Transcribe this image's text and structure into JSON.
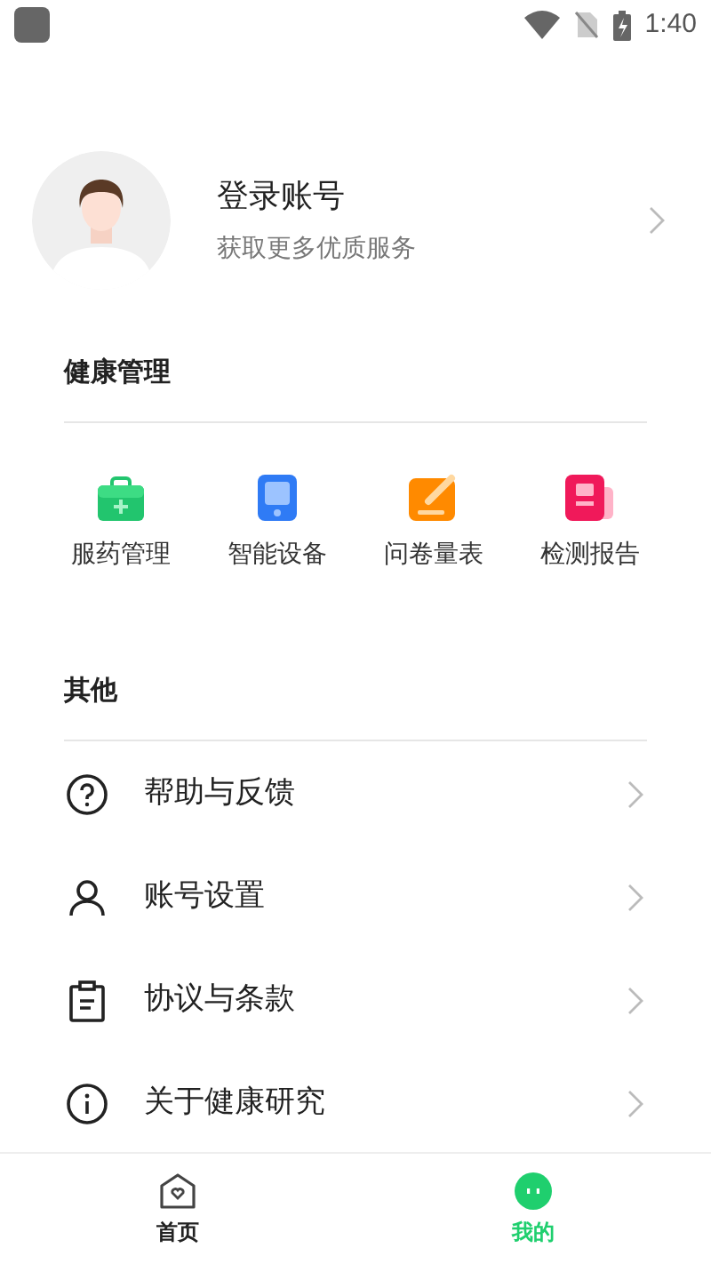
{
  "status_bar": {
    "time": "1:40"
  },
  "profile": {
    "name": "登录账号",
    "subtitle": "获取更多优质服务"
  },
  "health": {
    "title": "健康管理",
    "items": [
      {
        "label": "服药管理",
        "kind": "medicine"
      },
      {
        "label": "智能设备",
        "kind": "device"
      },
      {
        "label": "问卷量表",
        "kind": "survey"
      },
      {
        "label": "检测报告",
        "kind": "report"
      }
    ]
  },
  "other": {
    "title": "其他",
    "items": [
      {
        "label": "帮助与反馈",
        "kind": "help"
      },
      {
        "label": "账号设置",
        "kind": "account"
      },
      {
        "label": "协议与条款",
        "kind": "terms"
      },
      {
        "label": "关于健康研究",
        "kind": "about"
      }
    ]
  },
  "bottom_nav": [
    {
      "label": "首页",
      "kind": "home",
      "selected": false
    },
    {
      "label": "我的",
      "kind": "me",
      "selected": true
    }
  ]
}
